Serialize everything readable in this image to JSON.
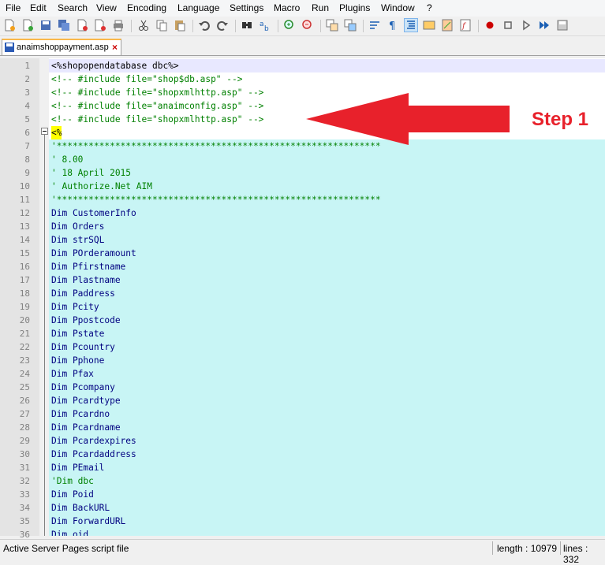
{
  "menu": [
    "File",
    "Edit",
    "Search",
    "View",
    "Encoding",
    "Language",
    "Settings",
    "Macro",
    "Run",
    "Plugins",
    "Window",
    "?"
  ],
  "toolbar_icons": [
    "new-icon",
    "open-icon",
    "save-icon",
    "save-all-icon",
    "close-icon",
    "close-all-icon",
    "print-icon",
    "cut-icon",
    "copy-icon",
    "paste-icon",
    "undo-icon",
    "redo-icon",
    "find-icon",
    "replace-icon",
    "zoom-in-icon",
    "zoom-out-icon",
    "sync-v-icon",
    "sync-h-icon",
    "word-wrap-icon",
    "show-all-chars-icon",
    "indent-guide-icon",
    "udl-icon",
    "doc-map-icon",
    "func-list-icon",
    "record-macro-icon",
    "stop-macro-icon",
    "play-macro-icon",
    "run-multiple-icon",
    "save-macro-icon"
  ],
  "tab": {
    "title": "anaimshoppayment.asp",
    "close": "×"
  },
  "lines": [
    {
      "n": "1",
      "text": "<%shopopendatabase dbc%>",
      "kind": "asp"
    },
    {
      "n": "2",
      "text": "<!-- #include file=\"shop$db.asp\" -->",
      "kind": "comment"
    },
    {
      "n": "3",
      "text": "<!-- #include file=\"shopxmlhttp.asp\" -->",
      "kind": "comment"
    },
    {
      "n": "4",
      "text": "<!-- #include file=\"anaimconfig.asp\" -->",
      "kind": "comment"
    },
    {
      "n": "5",
      "text": "<!-- #include file=\"shopxmlhttp.asp\" -->",
      "kind": "comment"
    },
    {
      "n": "6",
      "text": "<%",
      "kind": "open"
    },
    {
      "n": "7",
      "text": "'*************************************************************",
      "kind": "vbcomment"
    },
    {
      "n": "8",
      "text": "' 8.00",
      "kind": "vbcomment"
    },
    {
      "n": "9",
      "text": "' 18 April 2015",
      "kind": "vbcomment"
    },
    {
      "n": "10",
      "text": "' Authorize.Net AIM",
      "kind": "vbcomment"
    },
    {
      "n": "11",
      "text": "'*************************************************************",
      "kind": "vbcomment"
    },
    {
      "n": "12",
      "text": "Dim CustomerInfo",
      "kind": "code"
    },
    {
      "n": "13",
      "text": "Dim Orders",
      "kind": "code"
    },
    {
      "n": "14",
      "text": "Dim strSQL",
      "kind": "code"
    },
    {
      "n": "15",
      "text": "Dim POrderamount",
      "kind": "code"
    },
    {
      "n": "16",
      "text": "Dim Pfirstname",
      "kind": "code"
    },
    {
      "n": "17",
      "text": "Dim Plastname",
      "kind": "code"
    },
    {
      "n": "18",
      "text": "Dim Paddress",
      "kind": "code"
    },
    {
      "n": "19",
      "text": "Dim Pcity",
      "kind": "code"
    },
    {
      "n": "20",
      "text": "Dim Ppostcode",
      "kind": "code"
    },
    {
      "n": "21",
      "text": "Dim Pstate",
      "kind": "code"
    },
    {
      "n": "22",
      "text": "Dim Pcountry",
      "kind": "code"
    },
    {
      "n": "23",
      "text": "Dim Pphone",
      "kind": "code"
    },
    {
      "n": "24",
      "text": "Dim Pfax",
      "kind": "code"
    },
    {
      "n": "25",
      "text": "Dim Pcompany",
      "kind": "code"
    },
    {
      "n": "26",
      "text": "Dim Pcardtype",
      "kind": "code"
    },
    {
      "n": "27",
      "text": "Dim Pcardno",
      "kind": "code"
    },
    {
      "n": "28",
      "text": "Dim Pcardname",
      "kind": "code"
    },
    {
      "n": "29",
      "text": "Dim Pcardexpires",
      "kind": "code"
    },
    {
      "n": "30",
      "text": "Dim Pcardaddress",
      "kind": "code"
    },
    {
      "n": "31",
      "text": "Dim PEmail",
      "kind": "code"
    },
    {
      "n": "32",
      "text": "'Dim dbc",
      "kind": "vbcomment"
    },
    {
      "n": "33",
      "text": "Dim Poid",
      "kind": "code"
    },
    {
      "n": "34",
      "text": "Dim BackURL",
      "kind": "code"
    },
    {
      "n": "35",
      "text": "Dim ForwardURL",
      "kind": "code"
    },
    {
      "n": "36",
      "text": "Dim oid",
      "kind": "code"
    }
  ],
  "annotation": {
    "label": "Step 1",
    "color": "#e8212b"
  },
  "colors": {
    "asp_bg": "#e8e8ff",
    "script_bg": "#c8f5f5",
    "comment": "#008000",
    "code": "#000080",
    "highlight": "#ffff00"
  },
  "status": {
    "filetype": "Active Server Pages script file",
    "length": "length : 10979",
    "lines": "lines : 332"
  }
}
